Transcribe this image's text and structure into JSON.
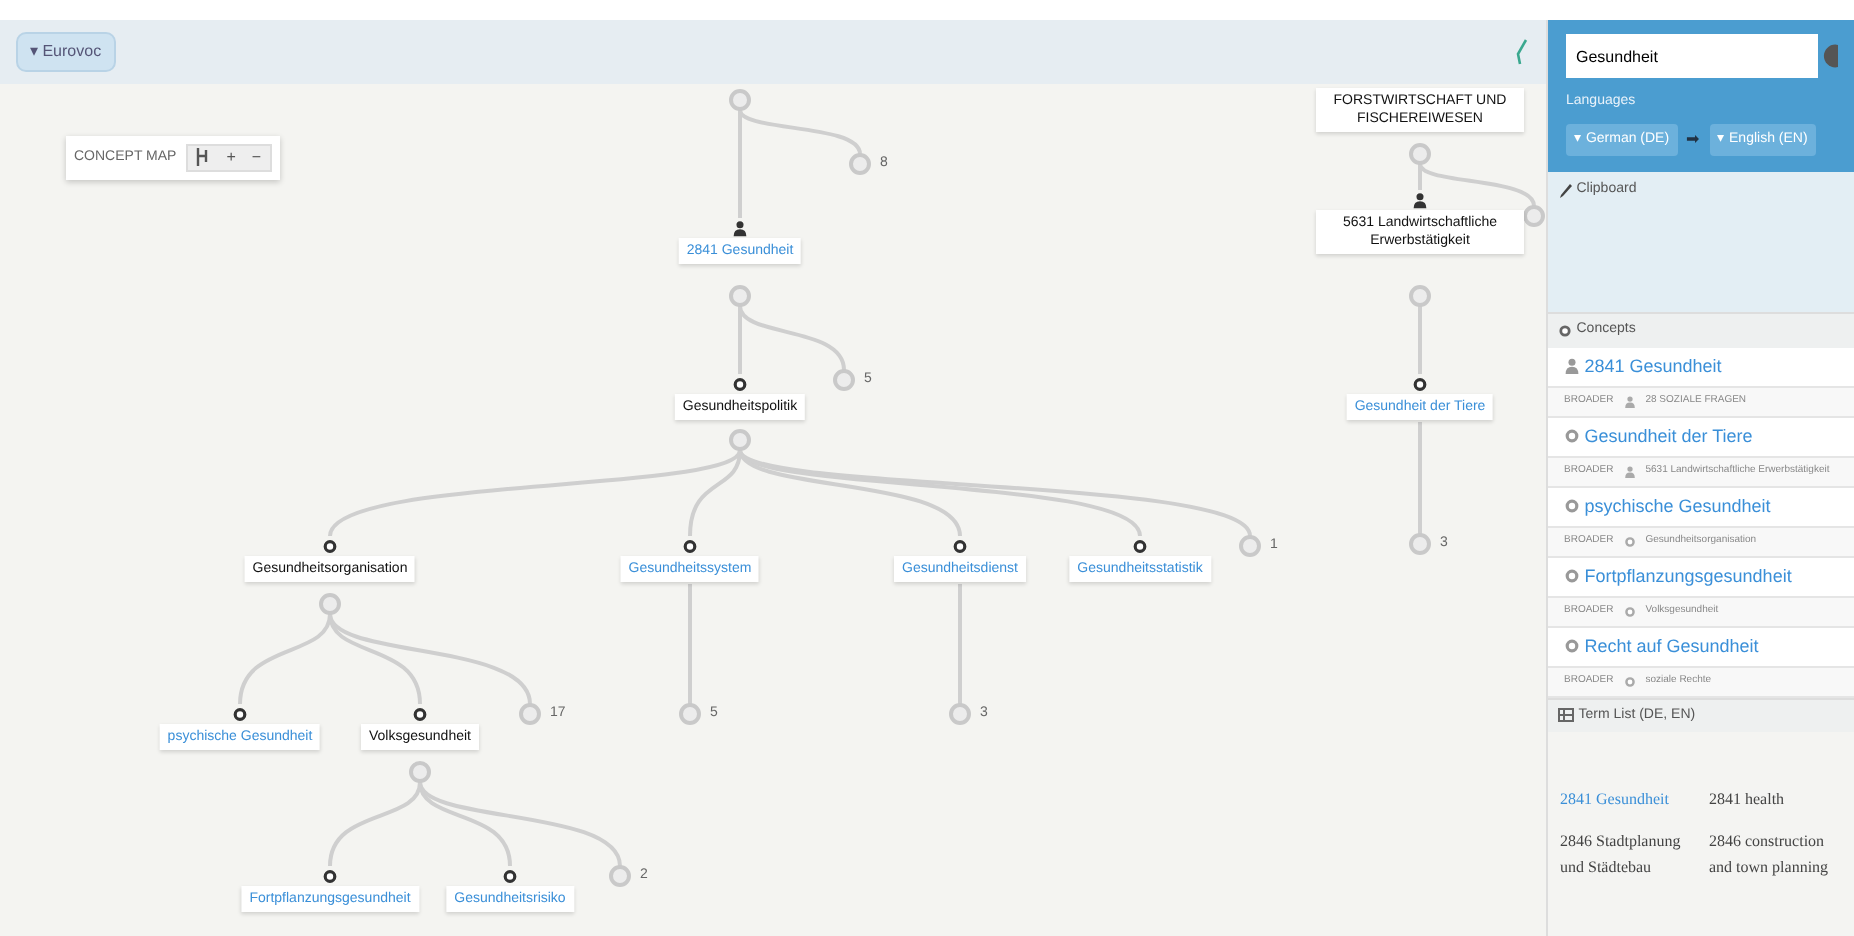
{
  "topbar": {
    "vocabulary_button": "▾ Eurovoc"
  },
  "concept_map": {
    "title": "CONCEPT MAP",
    "tools": [
      "+",
      "−"
    ],
    "trees": [
      {
        "kind": "handle",
        "children": [
          {
            "kind": "person",
            "label": "2841 Gesundheit",
            "linked": true,
            "expanded": true,
            "children": [
              {
                "kind": "dot",
                "label": "Gesundheitspolitik",
                "linked": false,
                "expanded": true,
                "children": [
                  {
                    "kind": "dot",
                    "label": "Gesundheitsorganisation",
                    "linked": false,
                    "expanded": true,
                    "children": [
                      {
                        "kind": "dot",
                        "label": "psychische Gesundheit",
                        "linked": true,
                        "expanded": false
                      },
                      {
                        "kind": "dot",
                        "label": "Volksgesundheit",
                        "linked": false,
                        "expanded": true,
                        "children": [
                          {
                            "kind": "dot",
                            "label": "Fortpflanzungsgesundheit",
                            "linked": true,
                            "expanded": false
                          },
                          {
                            "kind": "dot",
                            "label": "Gesundheitsrisiko",
                            "linked": true,
                            "expanded": false
                          },
                          {
                            "kind": "count",
                            "label": "2"
                          }
                        ]
                      },
                      {
                        "kind": "count",
                        "label": "17"
                      }
                    ]
                  },
                  {
                    "kind": "dot",
                    "label": "Gesundheitssystem",
                    "linked": true,
                    "expanded": false,
                    "children": [
                      {
                        "kind": "count",
                        "label": "5"
                      }
                    ]
                  },
                  {
                    "kind": "dot",
                    "label": "Gesundheitsdienst",
                    "linked": true,
                    "expanded": false,
                    "children": [
                      {
                        "kind": "count",
                        "label": "3"
                      }
                    ]
                  },
                  {
                    "kind": "dot",
                    "label": "Gesundheitsstatistik",
                    "linked": true,
                    "expanded": false
                  },
                  {
                    "kind": "count",
                    "label": "1"
                  }
                ]
              },
              {
                "kind": "count",
                "label": "5"
              }
            ]
          },
          {
            "kind": "count",
            "label": "8"
          }
        ]
      },
      {
        "kind": "plain",
        "label": "FORSTWIRTSCHAFT UND FISCHEREIWESEN",
        "linked": false,
        "expanded": true,
        "children": [
          {
            "kind": "person",
            "label": "5631 Landwirtschaftliche Erwerbstätigkeit",
            "linked": false,
            "expanded": true,
            "children": [
              {
                "kind": "dot",
                "label": "Gesundheit der Tiere",
                "linked": true,
                "expanded": false,
                "children": [
                  {
                    "kind": "count",
                    "label": "3"
                  }
                ]
              }
            ]
          },
          {
            "kind": "handle"
          }
        ]
      }
    ]
  },
  "panel": {
    "search": {
      "value": "Gesundheit"
    },
    "languages": {
      "title": "Languages",
      "source": "▾ German (DE)",
      "arrow": "➡",
      "target": "▾ English (EN)"
    },
    "clipboard": {
      "title": "Clipboard"
    },
    "concepts": {
      "title": "Concepts",
      "items": [
        {
          "kind": "person",
          "label": "2841 Gesundheit",
          "broader_tag": "BROADER",
          "broader": {
            "kind": "person",
            "label": "28 SOZIALE FRAGEN"
          }
        },
        {
          "kind": "dot",
          "label": "Gesundheit der Tiere",
          "broader_tag": "BROADER",
          "broader": {
            "kind": "person",
            "label": "5631 Landwirtschaftliche Erwerbstätigkeit"
          }
        },
        {
          "kind": "dot",
          "label": "psychische Gesundheit",
          "broader_tag": "BROADER",
          "broader": {
            "kind": "dot",
            "label": "Gesundheitsorganisation"
          }
        },
        {
          "kind": "dot",
          "label": "Fortpflanzungsgesundheit",
          "broader_tag": "BROADER",
          "broader": {
            "kind": "dot",
            "label": "Volksgesundheit"
          }
        },
        {
          "kind": "dot",
          "label": "Recht auf Gesundheit",
          "broader_tag": "BROADER",
          "broader": {
            "kind": "dot",
            "label": "soziale Rechte"
          }
        }
      ]
    },
    "term_list": {
      "title": "Term List (DE, EN)",
      "rows": [
        {
          "source": "2841 Gesundheit",
          "linked": true,
          "target": "2841 health"
        },
        {
          "source": "2846 Stadtplanung und Städtebau",
          "linked": false,
          "target": "2846 construction and town planning"
        }
      ]
    }
  }
}
